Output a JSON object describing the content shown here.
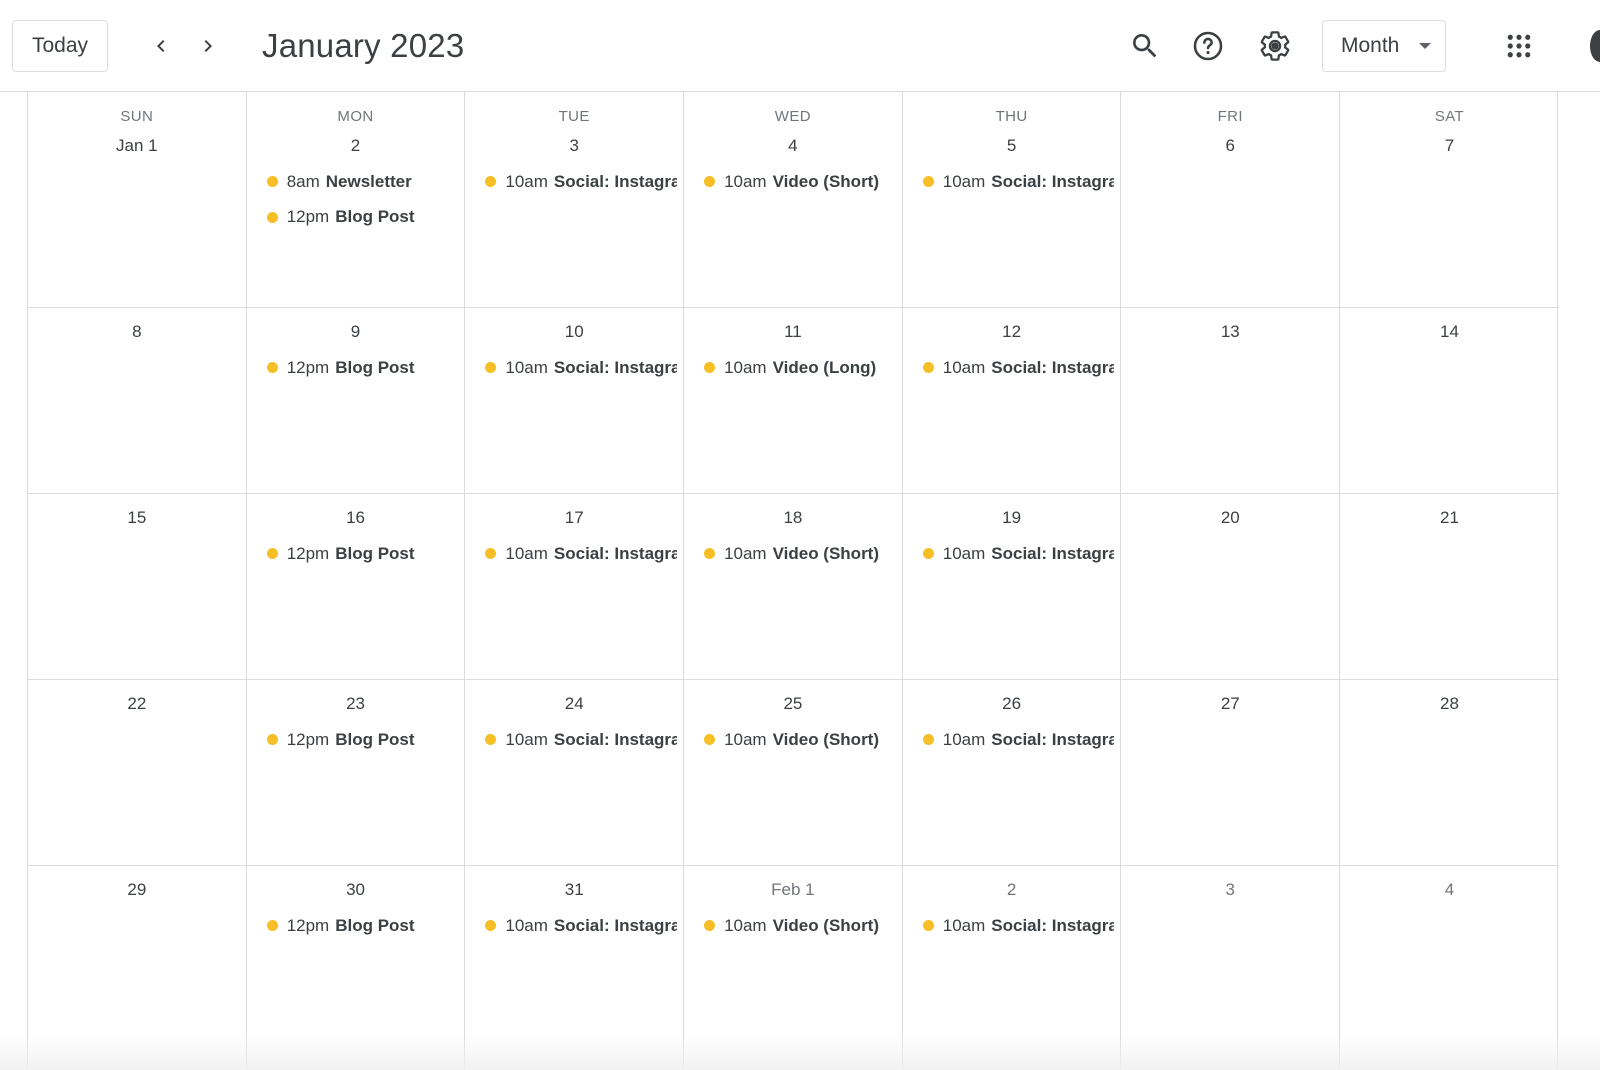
{
  "header": {
    "today_label": "Today",
    "title": "January 2023",
    "view_label": "Month"
  },
  "icons": {
    "prev": "chevron-left-icon",
    "next": "chevron-right-icon",
    "search": "search-icon",
    "help": "help-icon",
    "settings": "gear-icon",
    "apps": "apps-grid-icon"
  },
  "colors": {
    "event_dot": "#f6bf26",
    "grid_line": "#dadce0",
    "text": "#3c4043",
    "muted": "#70757a"
  },
  "weekdays": [
    "SUN",
    "MON",
    "TUE",
    "WED",
    "THU",
    "FRI",
    "SAT"
  ],
  "weeks": [
    [
      {
        "label": "Jan 1",
        "events": []
      },
      {
        "label": "2",
        "events": [
          {
            "time": "8am",
            "title": "Newsletter"
          },
          {
            "time": "12pm",
            "title": "Blog Post"
          }
        ]
      },
      {
        "label": "3",
        "events": [
          {
            "time": "10am",
            "title": "Social: Instagra"
          }
        ]
      },
      {
        "label": "4",
        "events": [
          {
            "time": "10am",
            "title": "Video (Short)"
          }
        ]
      },
      {
        "label": "5",
        "events": [
          {
            "time": "10am",
            "title": "Social: Instagra"
          }
        ]
      },
      {
        "label": "6",
        "events": []
      },
      {
        "label": "7",
        "events": []
      }
    ],
    [
      {
        "label": "8",
        "events": []
      },
      {
        "label": "9",
        "events": [
          {
            "time": "12pm",
            "title": "Blog Post"
          }
        ]
      },
      {
        "label": "10",
        "events": [
          {
            "time": "10am",
            "title": "Social: Instagra"
          }
        ]
      },
      {
        "label": "11",
        "events": [
          {
            "time": "10am",
            "title": "Video (Long)"
          }
        ]
      },
      {
        "label": "12",
        "events": [
          {
            "time": "10am",
            "title": "Social: Instagra"
          }
        ]
      },
      {
        "label": "13",
        "events": []
      },
      {
        "label": "14",
        "events": []
      }
    ],
    [
      {
        "label": "15",
        "events": []
      },
      {
        "label": "16",
        "events": [
          {
            "time": "12pm",
            "title": "Blog Post"
          }
        ]
      },
      {
        "label": "17",
        "events": [
          {
            "time": "10am",
            "title": "Social: Instagra"
          }
        ]
      },
      {
        "label": "18",
        "events": [
          {
            "time": "10am",
            "title": "Video (Short)"
          }
        ]
      },
      {
        "label": "19",
        "events": [
          {
            "time": "10am",
            "title": "Social: Instagra"
          }
        ]
      },
      {
        "label": "20",
        "events": []
      },
      {
        "label": "21",
        "events": []
      }
    ],
    [
      {
        "label": "22",
        "events": []
      },
      {
        "label": "23",
        "events": [
          {
            "time": "12pm",
            "title": "Blog Post"
          }
        ]
      },
      {
        "label": "24",
        "events": [
          {
            "time": "10am",
            "title": "Social: Instagra"
          }
        ]
      },
      {
        "label": "25",
        "events": [
          {
            "time": "10am",
            "title": "Video (Short)"
          }
        ]
      },
      {
        "label": "26",
        "events": [
          {
            "time": "10am",
            "title": "Social: Instagra"
          }
        ]
      },
      {
        "label": "27",
        "events": []
      },
      {
        "label": "28",
        "events": []
      }
    ],
    [
      {
        "label": "29",
        "events": []
      },
      {
        "label": "30",
        "events": [
          {
            "time": "12pm",
            "title": "Blog Post"
          }
        ]
      },
      {
        "label": "31",
        "events": [
          {
            "time": "10am",
            "title": "Social: Instagra"
          }
        ]
      },
      {
        "label": "Feb 1",
        "other_month": true,
        "events": [
          {
            "time": "10am",
            "title": "Video (Short)"
          }
        ]
      },
      {
        "label": "2",
        "other_month": true,
        "events": [
          {
            "time": "10am",
            "title": "Social: Instagra"
          }
        ]
      },
      {
        "label": "3",
        "other_month": true,
        "events": []
      },
      {
        "label": "4",
        "other_month": true,
        "events": []
      }
    ]
  ]
}
